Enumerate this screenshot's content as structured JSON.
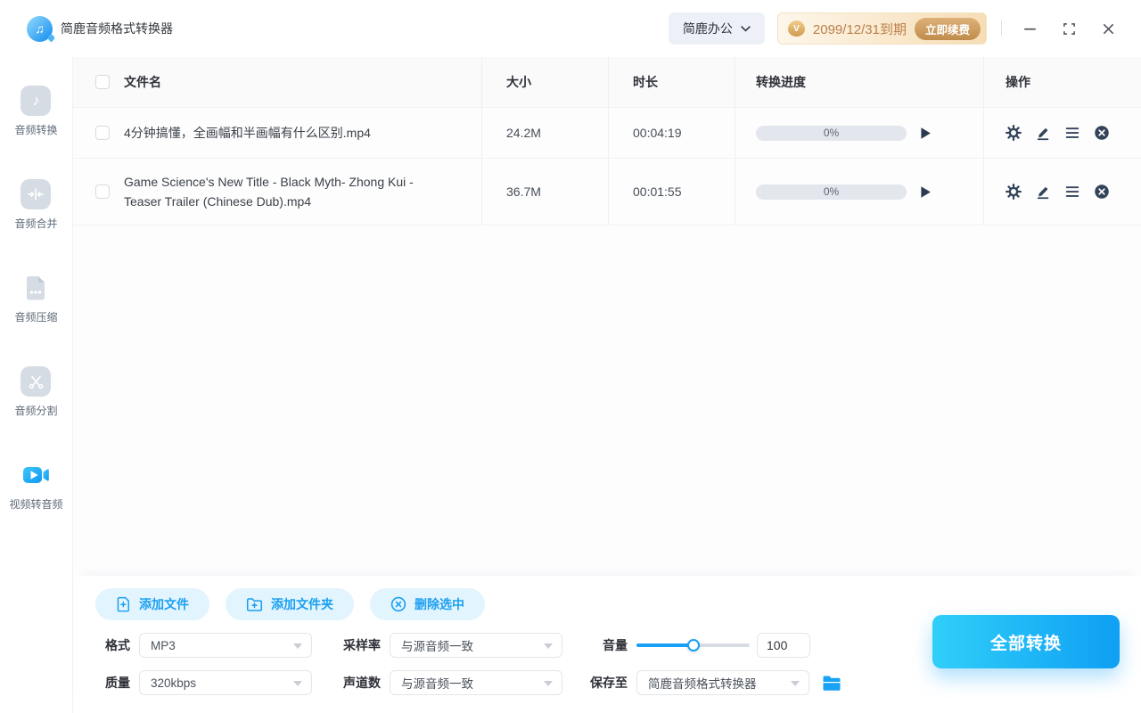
{
  "app": {
    "title": "简鹿音频格式转换器",
    "workspace_menu": "简鹿办公",
    "license": {
      "expiry": "2099/12/31到期",
      "renew": "立即续费",
      "vip_letter": "V"
    }
  },
  "window_controls": {
    "minimize": "minimize",
    "maximize": "maximize",
    "close": "close"
  },
  "sidebar": {
    "items": [
      {
        "label": "音频转换",
        "icon": "music-note-icon",
        "active": false
      },
      {
        "label": "音频合并",
        "icon": "merge-icon",
        "active": false
      },
      {
        "label": "音频压缩",
        "icon": "compress-file-icon",
        "active": false
      },
      {
        "label": "音频分割",
        "icon": "scissors-icon",
        "active": false
      },
      {
        "label": "视频转音频",
        "icon": "video-camera-icon",
        "active": true
      }
    ]
  },
  "table": {
    "headers": {
      "name": "文件名",
      "size": "大小",
      "duration": "时长",
      "progress": "转换进度",
      "actions": "操作"
    },
    "rows": [
      {
        "name": "4分钟搞懂，全画幅和半画幅有什么区别.mp4",
        "size": "24.2M",
        "duration": "00:04:19",
        "progress": "0%",
        "progress_percent": 0
      },
      {
        "name": "Game Science's New Title - Black Myth- Zhong Kui - Teaser Trailer (Chinese Dub).mp4",
        "size": "36.7M",
        "duration": "00:01:55",
        "progress": "0%",
        "progress_percent": 0
      }
    ],
    "row_action_icons": [
      "settings-gear-icon",
      "edit-pencil-icon",
      "menu-icon",
      "remove-circle-icon"
    ]
  },
  "toolbar": {
    "add_file": "添加文件",
    "add_folder": "添加文件夹",
    "delete_selected": "删除选中"
  },
  "settings": {
    "format": {
      "label": "格式",
      "value": "MP3"
    },
    "quality": {
      "label": "质量",
      "value": "320kbps"
    },
    "sample_rate": {
      "label": "采样率",
      "value": "与源音频一致"
    },
    "channels": {
      "label": "声道数",
      "value": "与源音频一致"
    },
    "volume": {
      "label": "音量",
      "value": "100",
      "percent": 50
    },
    "save_to": {
      "label": "保存至",
      "value": "简鹿音频格式转换器"
    }
  },
  "convert_all_label": "全部转换",
  "colors": {
    "accent_blue": "#19a2f5",
    "convert_gradient": [
      "#30cff8",
      "#0f9ff4"
    ],
    "light_blue_button_bg": "#e2f4fe",
    "vip_text": "#ba8049",
    "vip_bg": [
      "#fdf6ea",
      "#f6ddb5"
    ],
    "icon_dark": "#32435a",
    "progress_track": "#e3e6ec"
  }
}
